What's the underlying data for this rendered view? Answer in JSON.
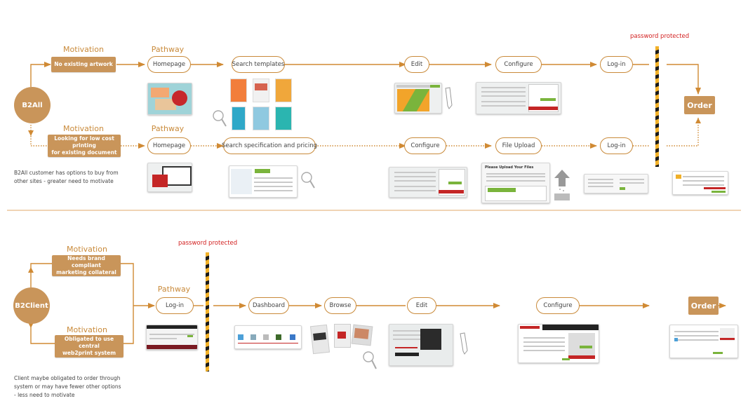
{
  "b2all": {
    "node_label": "B2All",
    "top_path": {
      "motivation_heading": "Motivation",
      "motivation_text": "No existing artwork",
      "pathway_heading": "Pathway",
      "steps": [
        "Homepage",
        "Search templates",
        "Edit",
        "Configure",
        "Log-in"
      ]
    },
    "bottom_path": {
      "motivation_heading": "Motivation",
      "motivation_lines": [
        "Looking for low cost printing",
        "for existing document"
      ],
      "pathway_heading": "Pathway",
      "steps": [
        "Homepage",
        "Search specification and pricing",
        "Configure",
        "File Upload",
        "Log-in"
      ]
    },
    "password_label": "password protected",
    "order_label": "Order",
    "note_lines": [
      "B2All customer has options to buy from",
      "other sites - greater need to motivate"
    ],
    "upload_thumb_title": "Please Upload Your Files"
  },
  "b2client": {
    "node_label": "B2Client",
    "motivation_top_heading": "Motivation",
    "motivation_top_lines": [
      "Needs brand compliant",
      "marketing collateral"
    ],
    "motivation_bottom_heading": "Motivation",
    "motivation_bottom_lines": [
      "Obligated to use central",
      "web2print system"
    ],
    "pathway_heading": "Pathway",
    "password_label": "password protected",
    "steps": [
      "Log-in",
      "Dashboard",
      "Browse",
      "Edit",
      "Configure"
    ],
    "order_label": "Order",
    "note_lines": [
      "Client maybe obligated to order through",
      "system or may have fewer other options",
      "- less need to motivate"
    ]
  },
  "colors": {
    "accent": "#c9955a",
    "line": "#d08a34",
    "password_red": "#d21f1f",
    "divider": "#f0d4b4",
    "hazard_yellow": "#f3b22a",
    "hazard_black": "#1a1a1a"
  }
}
